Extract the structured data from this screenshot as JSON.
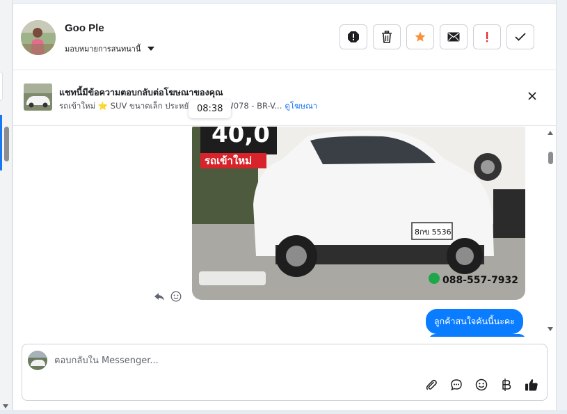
{
  "header": {
    "user_name": "Goo Ple",
    "assign_label": "มอบหมายการสนทนานี้",
    "actions": [
      "spam-icon",
      "trash-icon",
      "star-icon",
      "mail-icon",
      "alert-icon",
      "check-icon"
    ]
  },
  "ad": {
    "title": "แชทนี้มีข้อความตอบกลับต่อโฆษณาของคุณ",
    "subtitle": "รถเข้าใหม่ ⭐ SUV ขนาดเล็ก ประหยัด ครัว 🚗 W078 - BR-V...",
    "link": "ดูโฆษณา"
  },
  "chat": {
    "time": "08:38",
    "image_overlay_price": "40,0",
    "image_overlay_tag": "รถเข้าใหม่",
    "image_plate": "8กข 5536",
    "image_phone": "088-557-7932",
    "outgoing_message": "ลูกค้าสนใจคันนี้นะคะ"
  },
  "composer": {
    "placeholder": "ตอบกลับใน Messenger..."
  },
  "colors": {
    "accent": "#1877f2",
    "bubble": "#0a7cff",
    "star": "#f7923a",
    "alert": "#e4242b"
  }
}
